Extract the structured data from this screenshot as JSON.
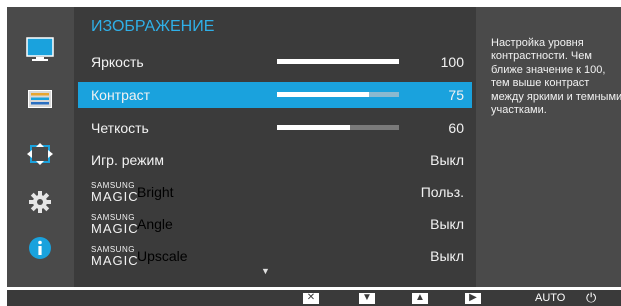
{
  "menu": {
    "title": "ИЗОБРАЖЕНИЕ",
    "rows": [
      {
        "label": "Яркость",
        "value": "100",
        "level": 100
      },
      {
        "label": "Контраст",
        "value": "75",
        "level": 75,
        "selected": true
      },
      {
        "label": "Четкость",
        "value": "60",
        "level": 60
      },
      {
        "label": "Игр. режим",
        "value": "Выкл"
      }
    ],
    "magic_rows": [
      {
        "brand_top": "SAMSUNG",
        "brand_bottom": "MAGIC",
        "name": "Bright",
        "value": "Польз."
      },
      {
        "brand_top": "SAMSUNG",
        "brand_bottom": "MAGIC",
        "name": "Angle",
        "value": "Выкл"
      },
      {
        "brand_top": "SAMSUNG",
        "brand_bottom": "MAGIC",
        "name": "Upscale",
        "value": "Выкл"
      }
    ],
    "scroll_indicator": "▼"
  },
  "help": {
    "text": "Настройка уровня контрастности. Чем ближе значение к 100, тем выше контраст между яркими и темными участками."
  },
  "sidebar": {
    "icons": [
      "monitor-icon",
      "picture-adjust-icon",
      "size-position-icon",
      "settings-gear-icon",
      "info-icon"
    ]
  },
  "bottom_bar": {
    "keys": [
      {
        "icon": "close-icon",
        "glyph": "✕"
      },
      {
        "icon": "down-arrow-icon",
        "glyph": "▼"
      },
      {
        "icon": "up-arrow-icon",
        "glyph": "▲"
      },
      {
        "icon": "right-arrow-icon",
        "glyph": "▶"
      }
    ],
    "auto_label": "AUTO",
    "power_glyph": "⏻"
  },
  "colors": {
    "accent": "#1aa2dd",
    "title": "#2fb0e8",
    "panel": "#3b3b3b",
    "frame": "#4a4a4a"
  }
}
